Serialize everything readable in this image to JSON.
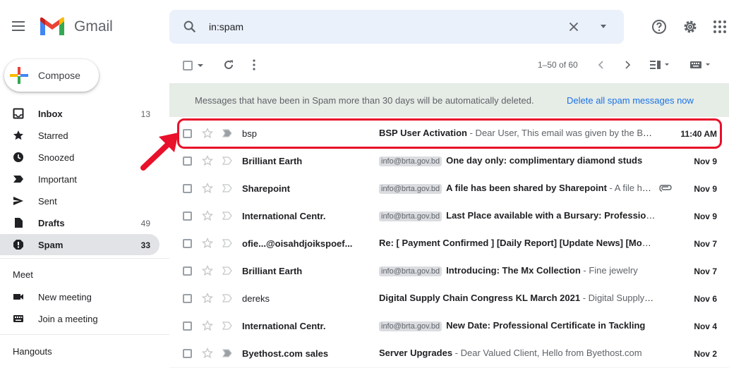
{
  "app": {
    "brand": "Gmail"
  },
  "search": {
    "query": "in:spam"
  },
  "compose": {
    "label": "Compose"
  },
  "nav": [
    {
      "label": "Inbox",
      "count": "13",
      "bold": true,
      "active": false,
      "icon": "inbox-icon"
    },
    {
      "label": "Starred",
      "count": "",
      "bold": false,
      "active": false,
      "icon": "star-icon"
    },
    {
      "label": "Snoozed",
      "count": "",
      "bold": false,
      "active": false,
      "icon": "clock-icon"
    },
    {
      "label": "Important",
      "count": "",
      "bold": false,
      "active": false,
      "icon": "important-icon"
    },
    {
      "label": "Sent",
      "count": "",
      "bold": false,
      "active": false,
      "icon": "send-icon"
    },
    {
      "label": "Drafts",
      "count": "49",
      "bold": true,
      "active": false,
      "icon": "draft-icon"
    },
    {
      "label": "Spam",
      "count": "33",
      "bold": true,
      "active": true,
      "icon": "spam-icon"
    }
  ],
  "meet": {
    "title": "Meet",
    "items": [
      {
        "label": "New meeting",
        "icon": "video-icon"
      },
      {
        "label": "Join a meeting",
        "icon": "keyboard-icon"
      }
    ]
  },
  "hangouts": {
    "title": "Hangouts"
  },
  "toolbar": {
    "pager": "1–50 of 60"
  },
  "banner": {
    "message": "Messages that have been in Spam more than 30 days will be automatically deleted.",
    "action": "Delete all spam messages now"
  },
  "emails": [
    {
      "sender": "bsp",
      "tag": "",
      "subject": "BSP User Activation",
      "snippet": " - Dear User, This email was given by the BSP Team",
      "date": "11:40 AM",
      "unread": false,
      "attachment": false
    },
    {
      "sender": "Brilliant Earth",
      "tag": "info@brta.gov.bd",
      "subject": "One day only: complimentary diamond studs",
      "snippet": "",
      "date": "Nov 9",
      "unread": true,
      "attachment": false
    },
    {
      "sender": "Sharepoint",
      "tag": "info@brta.gov.bd",
      "subject": "A file has been shared by Sharepoint",
      "snippet": " - A file has been shared",
      "date": "Nov 9",
      "unread": true,
      "attachment": true
    },
    {
      "sender": "International Centr.",
      "tag": "info@brta.gov.bd",
      "subject": "Last Place available with a Bursary: Professional",
      "snippet": "",
      "date": "Nov 9",
      "unread": true,
      "attachment": false
    },
    {
      "sender": "ofie...@oisahdjoikspoef...",
      "tag": "",
      "subject": "Re: [ Payment Confirmed ] [Daily Report] [Update News] [Mobile]",
      "snippet": "",
      "date": "Nov 7",
      "unread": true,
      "attachment": false
    },
    {
      "sender": "Brilliant Earth",
      "tag": "info@brta.gov.bd",
      "subject": "Introducing: The Mx Collection",
      "snippet": " - Fine jewelry",
      "date": "Nov 7",
      "unread": true,
      "attachment": false
    },
    {
      "sender": "dereks",
      "tag": "",
      "subject": "Digital Supply Chain Congress KL March 2021",
      "snippet": " - Digital Supply Chain",
      "date": "Nov 6",
      "unread": false,
      "attachment": false
    },
    {
      "sender": "International Centr.",
      "tag": "info@brta.gov.bd",
      "subject": "New Date: Professional Certificate in Tackling",
      "snippet": "",
      "date": "Nov 4",
      "unread": true,
      "attachment": false
    },
    {
      "sender": "Byethost.com sales",
      "tag": "",
      "subject": "Server Upgrades",
      "snippet": " - Dear Valued Client, Hello from Byethost.com",
      "date": "Nov 2",
      "unread": true,
      "attachment": false
    }
  ],
  "colors": {
    "highlight": "#e8102a",
    "banner_bg": "#e6ece6",
    "link": "#1a73e8"
  }
}
